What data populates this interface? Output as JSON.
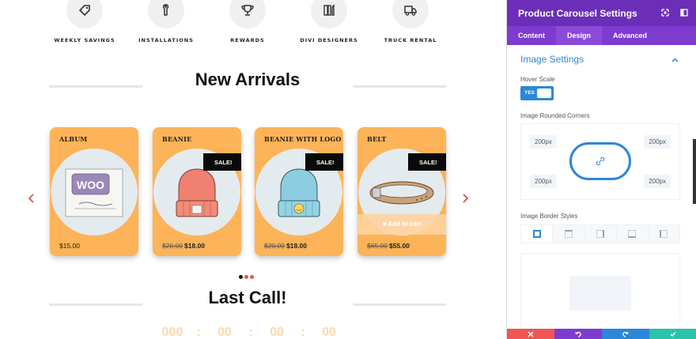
{
  "categories": [
    {
      "label": "WEEKLY SAVINGS",
      "icon": "tag-icon"
    },
    {
      "label": "INSTALLATIONS",
      "icon": "wrench-icon"
    },
    {
      "label": "REWARDS",
      "icon": "trophy-icon"
    },
    {
      "label": "DIVI DESIGNERS",
      "icon": "pencils-icon"
    },
    {
      "label": "TRUCK RENTAL",
      "icon": "truck-icon"
    }
  ],
  "new_arrivals_title": "New Arrivals",
  "last_call_title": "Last Call!",
  "products": [
    {
      "title": "ALBUM",
      "price": "$15.00",
      "old_price": "",
      "sale": "",
      "image": "woo-album-image"
    },
    {
      "title": "BEANIE",
      "price": "$18.00",
      "old_price": "$20.00",
      "sale": "SALE!",
      "image": "red-beanie-image"
    },
    {
      "title": "BEANIE WITH LOGO",
      "price": "$18.00",
      "old_price": "$20.00",
      "sale": "SALE!",
      "image": "blue-beanie-image"
    },
    {
      "title": "BELT",
      "price": "$55.00",
      "old_price": "$65.00",
      "sale": "SALE!",
      "image": "belt-image",
      "add_to_cart": "Add to cart"
    }
  ],
  "album_art_text": "WOO",
  "countdown": [
    "000",
    ":",
    "00",
    ":",
    "00",
    ":",
    "00"
  ],
  "colors": {
    "card": "#fdb357",
    "accent_blue": "#2b87da",
    "purple_header": "#6c2eb9",
    "arrow_red": "#d9534f"
  },
  "panel": {
    "title": "Product Carousel Settings",
    "tabs": [
      {
        "label": "Content",
        "active": false
      },
      {
        "label": "Design",
        "active": true
      },
      {
        "label": "Advanced",
        "active": false
      }
    ],
    "group_title": "Image Settings",
    "hover_scale_label": "Hover Scale",
    "hover_scale_toggle": "YES",
    "rounded_corners_label": "Image Rounded Corners",
    "corners": {
      "top_left": "200px",
      "top_right": "200px",
      "bottom_left": "200px",
      "bottom_right": "200px"
    },
    "border_styles_label": "Image Border Styles"
  },
  "footer_buttons": [
    {
      "name": "cancel-button",
      "icon": "close-icon",
      "color": "#ef5555"
    },
    {
      "name": "undo-button",
      "icon": "undo-icon",
      "color": "#7e3bd0"
    },
    {
      "name": "redo-button",
      "icon": "redo-icon",
      "color": "#2b87da"
    },
    {
      "name": "save-button",
      "icon": "check-icon",
      "color": "#29c4a9"
    }
  ]
}
